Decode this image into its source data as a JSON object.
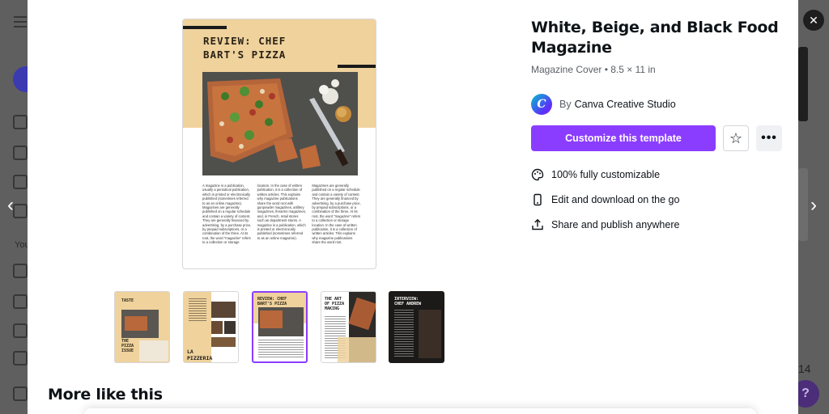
{
  "background": {
    "you_label": "You",
    "page_num": "14",
    "help_label": "?"
  },
  "modal": {
    "title": "White, Beige, and Black Food Magazine",
    "meta": "Magazine Cover • 8.5 × 11 in",
    "author_prefix": "By",
    "author_name": "Canva Creative Studio",
    "logo_letter": "C",
    "cta_label": "Customize this template",
    "features": [
      {
        "icon": "palette-icon",
        "label": "100% fully customizable"
      },
      {
        "icon": "phone-icon",
        "label": "Edit and download on the go"
      },
      {
        "icon": "share-icon",
        "label": "Share and publish anywhere"
      }
    ],
    "more_like_this": "More like this",
    "close_label": "✕",
    "prev_label": "‹",
    "next_label": "›"
  },
  "cover": {
    "headline_line1": "REVIEW: CHEF",
    "headline_line2": "BART'S PIZZA",
    "columns": [
      "A magazine is a publication, usually a periodical publication, which is printed or electronically published (sometimes referred to as an online magazine). Magazines are generally published on a regular schedule and contain a variety of content. They are generally financed by advertising, by a purchase price, by prepaid subscriptions, or a combination of the three. At its root, the word \"magazine\" refers to a collection or storage",
      "location. In the case of written publication, it is a collection of written articles. This explains why magazine publications share the word root with gunpowder magazines, artillery magazines, firearms magazines, and, in French, retail stores such as department stores. A magazine is a publication, which is printed or electronically published (sometimes referred to as an online magazine).",
      "Magazines are generally published on a regular schedule and contain a variety of content. They are generally financed by advertising, by a purchase price, by prepaid subscriptions, or a combination of the three. At its root, the word \"magazine\" refers to a collection or storage location. In the case of written publication, it is a collection of written articles. This explains why magazine publications share the word root."
    ]
  },
  "thumbnails": [
    {
      "label": "TASTE",
      "sub": "THE PIZZA ISSUE"
    },
    {
      "label": "LA PIZZERIA"
    },
    {
      "label": "REVIEW: CHEF BART'S PIZZA",
      "selected": true
    },
    {
      "label": "THE ART OF PIZZA MAKING"
    },
    {
      "label": "INTERVIEW: CHEF ANDREW"
    }
  ],
  "colors": {
    "accent": "#8b3dff",
    "beige": "#efd29c",
    "dark": "#1a1a1a"
  }
}
